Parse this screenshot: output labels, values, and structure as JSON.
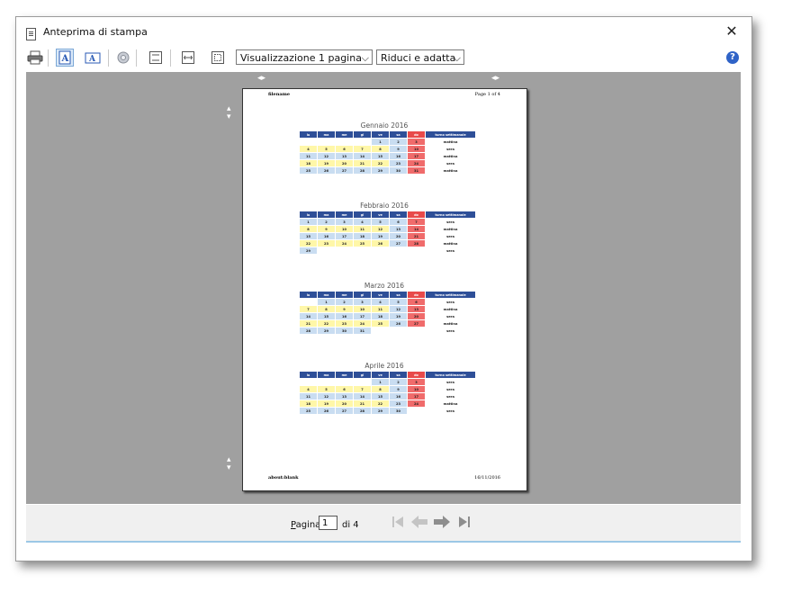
{
  "window": {
    "title": "Anteprima di stampa",
    "close_label": "✕"
  },
  "toolbar": {
    "view_mode": "Visualizzazione 1 pagina",
    "scale_mode": "Riduci e adatta",
    "help_label": "?"
  },
  "page": {
    "header_left": "filename",
    "header_right": "Page 1 of 4",
    "footer_left": "about:blank",
    "footer_right": "16/11/2016",
    "day_headers": [
      "lu",
      "ma",
      "me",
      "gi",
      "ve",
      "sa",
      "do",
      "turno settimanale"
    ],
    "months": [
      {
        "title": "Gennaio 2016",
        "weeks": [
          {
            "days": [
              "",
              "",
              "",
              "",
              "1",
              "2",
              "3"
            ],
            "shift": "mattina"
          },
          {
            "days": [
              "4",
              "5",
              "6",
              "7",
              "8",
              "9",
              "10"
            ],
            "shift": "sera"
          },
          {
            "days": [
              "11",
              "12",
              "13",
              "14",
              "15",
              "16",
              "17"
            ],
            "shift": "mattina"
          },
          {
            "days": [
              "18",
              "19",
              "20",
              "21",
              "22",
              "23",
              "24"
            ],
            "shift": "sera"
          },
          {
            "days": [
              "25",
              "26",
              "27",
              "28",
              "29",
              "30",
              "31"
            ],
            "shift": "mattina"
          }
        ]
      },
      {
        "title": "Febbraio 2016",
        "weeks": [
          {
            "days": [
              "1",
              "2",
              "3",
              "4",
              "5",
              "6",
              "7"
            ],
            "shift": "sera"
          },
          {
            "days": [
              "8",
              "9",
              "10",
              "11",
              "12",
              "13",
              "14"
            ],
            "shift": "mattina"
          },
          {
            "days": [
              "15",
              "16",
              "17",
              "18",
              "19",
              "20",
              "21"
            ],
            "shift": "sera"
          },
          {
            "days": [
              "22",
              "23",
              "24",
              "25",
              "26",
              "27",
              "28"
            ],
            "shift": "mattina"
          },
          {
            "days": [
              "29",
              "",
              "",
              "",
              "",
              "",
              ""
            ],
            "shift": "sera"
          }
        ]
      },
      {
        "title": "Marzo 2016",
        "weeks": [
          {
            "days": [
              "",
              "1",
              "2",
              "3",
              "4",
              "5",
              "6"
            ],
            "shift": "sera"
          },
          {
            "days": [
              "7",
              "8",
              "9",
              "10",
              "11",
              "12",
              "13"
            ],
            "shift": "mattina"
          },
          {
            "days": [
              "14",
              "15",
              "16",
              "17",
              "18",
              "19",
              "20"
            ],
            "shift": "sera"
          },
          {
            "days": [
              "21",
              "22",
              "23",
              "24",
              "25",
              "26",
              "27"
            ],
            "shift": "mattina"
          },
          {
            "days": [
              "28",
              "29",
              "30",
              "31",
              "",
              "",
              ""
            ],
            "shift": "sera"
          }
        ]
      },
      {
        "title": "Aprile 2016",
        "weeks": [
          {
            "days": [
              "",
              "",
              "",
              "",
              "1",
              "2",
              "3"
            ],
            "shift": "sera"
          },
          {
            "days": [
              "4",
              "5",
              "6",
              "7",
              "8",
              "9",
              "10"
            ],
            "shift": "sera"
          },
          {
            "days": [
              "11",
              "12",
              "13",
              "14",
              "15",
              "16",
              "17"
            ],
            "shift": "sera"
          },
          {
            "days": [
              "18",
              "19",
              "20",
              "21",
              "22",
              "23",
              "24"
            ],
            "shift": "mattina"
          },
          {
            "days": [
              "25",
              "26",
              "27",
              "28",
              "29",
              "30",
              ""
            ],
            "shift": "sera"
          }
        ]
      }
    ]
  },
  "pager": {
    "label": "Pagina",
    "current": "1",
    "of_label": "di 4"
  },
  "colors": {
    "header_blue": "#2e4f98",
    "sunday_red": "#e84a4a",
    "weekday_yellow": "#fff7a8",
    "weekend_blue": "#c9ddf1",
    "preview_gray": "#a0a0a0"
  }
}
